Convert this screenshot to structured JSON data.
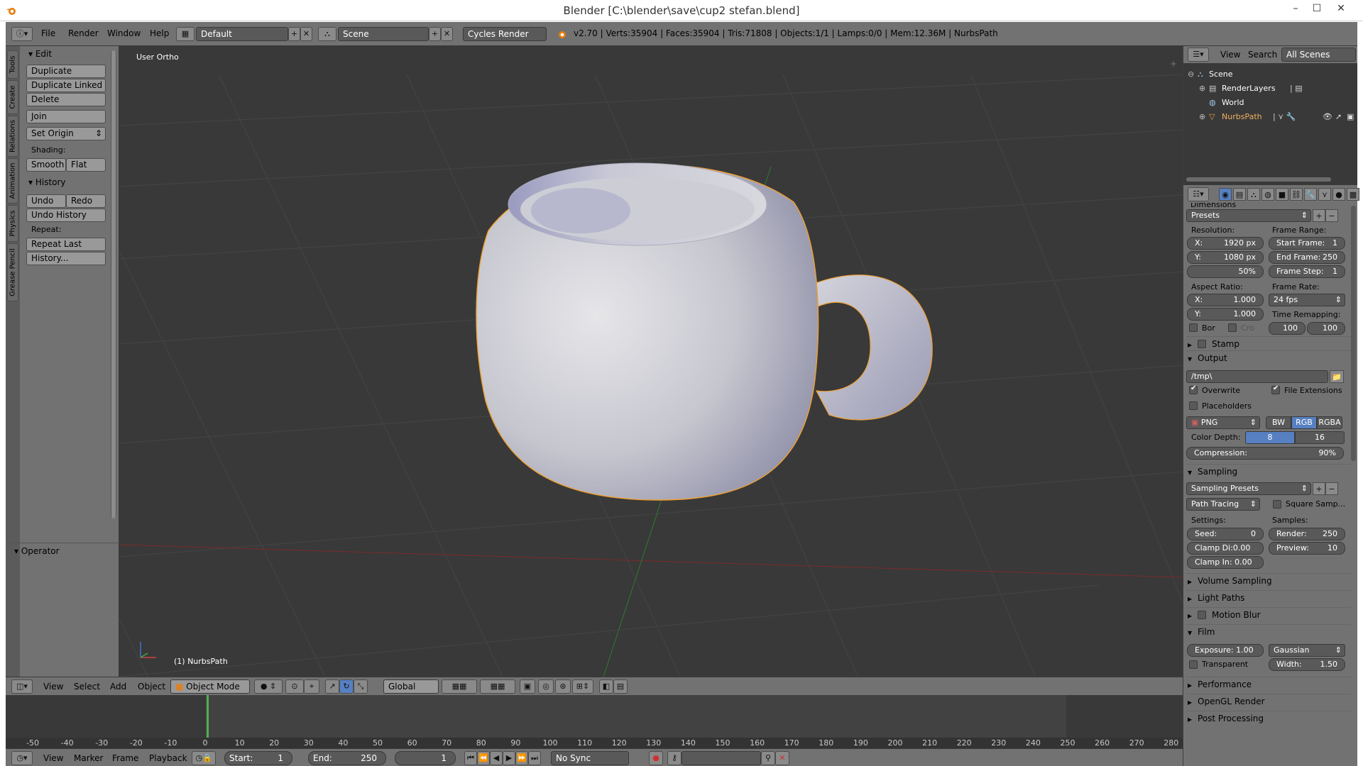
{
  "window": {
    "title": "Blender [C:\\blender\\save\\cup2 stefan.blend]",
    "controls": [
      "–",
      "☐",
      "✕"
    ]
  },
  "info_header": {
    "menus": [
      "File",
      "Render",
      "Window",
      "Help"
    ],
    "layout": "Default",
    "scene": "Scene",
    "engine": "Cycles Render",
    "stats": "v2.70 | Verts:35904 | Faces:35904 | Tris:71808 | Objects:1/1 | Lamps:0/0 | Mem:12.36M | NurbsPath"
  },
  "tool_shelf": {
    "tabs": [
      "Tools",
      "Create",
      "Relations",
      "Animation",
      "Physics",
      "Grease Pencil"
    ],
    "edit_panel": "Edit",
    "buttons": [
      "Duplicate",
      "Duplicate Linked",
      "Delete",
      "Join",
      "Set Origin"
    ],
    "shading_label": "Shading:",
    "shading": [
      "Smooth",
      "Flat"
    ],
    "history_panel": "History",
    "undo": "Undo",
    "redo": "Redo",
    "undo_history": "Undo History",
    "repeat_label": "Repeat:",
    "repeat_last": "Repeat Last",
    "history_btn": "History...",
    "operator_panel": "Operator"
  },
  "viewport": {
    "view_name": "User Ortho",
    "object_name": "(1) NurbsPath"
  },
  "header_3d": {
    "menus": [
      "View",
      "Select",
      "Add",
      "Object"
    ],
    "mode": "Object Mode",
    "orientation": "Global"
  },
  "timeline": {
    "ticks": [
      "-50",
      "-40",
      "-30",
      "-20",
      "-10",
      "0",
      "10",
      "20",
      "30",
      "40",
      "50",
      "60",
      "70",
      "80",
      "90",
      "100",
      "110",
      "120",
      "130",
      "140",
      "150",
      "160",
      "170",
      "180",
      "190",
      "200",
      "210",
      "220",
      "230",
      "240",
      "250",
      "260",
      "270",
      "280"
    ],
    "current_frame_marker": 0,
    "menus": [
      "View",
      "Marker",
      "Frame",
      "Playback"
    ],
    "start_label": "Start:",
    "start": "1",
    "end_label": "End:",
    "end": "250",
    "current": "1",
    "sync": "No Sync"
  },
  "outliner": {
    "menus": [
      "View",
      "Search"
    ],
    "filter": "All Scenes",
    "items": [
      "Scene",
      "RenderLayers",
      "World",
      "NurbsPath"
    ]
  },
  "properties": {
    "dimensions_title": "Dimensions",
    "presets": "Presets",
    "resolution_label": "Resolution:",
    "res_x_label": "X:",
    "res_x": "1920 px",
    "res_y_label": "Y:",
    "res_y": "1080 px",
    "res_pct": "50%",
    "frame_range_label": "Frame Range:",
    "start_frame_label": "Start Frame:",
    "start_frame": "1",
    "end_frame_label": "End Frame:",
    "end_frame": "250",
    "frame_step_label": "Frame Step:",
    "frame_step": "1",
    "aspect_label": "Aspect Ratio:",
    "asp_x_label": "X:",
    "asp_x": "1.000",
    "asp_y_label": "Y:",
    "asp_y": "1.000",
    "frame_rate_label": "Frame Rate:",
    "frame_rate": "24 fps",
    "time_remap_label": "Time Remapping:",
    "remap_old": "100",
    "remap_new": "100",
    "border": "Bor",
    "crop": "Cro",
    "stamp": "Stamp",
    "output": "Output",
    "output_path": "/tmp\\",
    "overwrite": "Overwrite",
    "file_extensions": "File Extensions",
    "placeholders": "Placeholders",
    "format": "PNG",
    "color_modes": [
      "BW",
      "RGB",
      "RGBA"
    ],
    "color_depth_label": "Color Depth:",
    "color_depths": [
      "8",
      "16"
    ],
    "compression_label": "Compression:",
    "compression": "90%",
    "sampling": "Sampling",
    "sampling_presets": "Sampling Presets",
    "integrator": "Path Tracing",
    "square_samples": "Square Samp...",
    "settings_label": "Settings:",
    "samples_label": "Samples:",
    "seed_label": "Seed:",
    "seed": "0",
    "clamp_direct": "Clamp Di:0.00",
    "clamp_indirect": "Clamp In: 0.00",
    "render_samples_label": "Render:",
    "render_samples": "250",
    "preview_samples_label": "Preview:",
    "preview_samples": "10",
    "sections_collapsed": [
      "Volume Sampling",
      "Light Paths",
      "Motion Blur"
    ],
    "film": "Film",
    "exposure": "Exposure: 1.00",
    "filter_type": "Gaussian",
    "transparent": "Transparent",
    "width_label": "Width:",
    "width": "1.50",
    "sections_bottom": [
      "Performance",
      "OpenGL Render",
      "Post Processing"
    ]
  },
  "colors": {
    "panel": "#727272",
    "viewport": "#393939",
    "selection_outline": "#f0a030",
    "selected_button": "#5680c2"
  }
}
